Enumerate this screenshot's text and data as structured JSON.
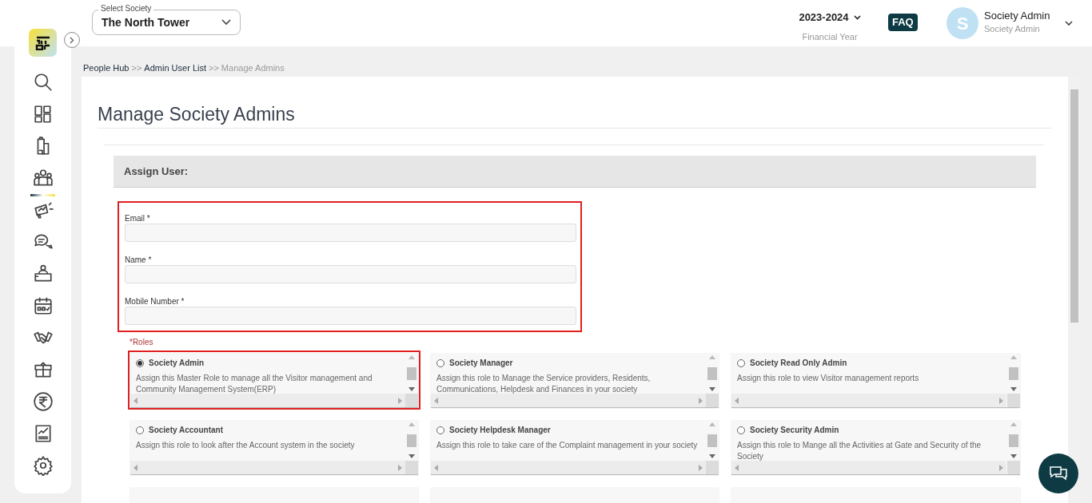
{
  "header": {
    "society_select": {
      "label": "Select Society",
      "value": "The North Tower"
    },
    "financial_year": {
      "value": "2023-2024",
      "label": "Financial Year"
    },
    "faq": "FAQ",
    "user": {
      "initial": "S",
      "name": "Society Admin",
      "role": "Society Admin"
    }
  },
  "sidebar": {
    "items": [
      {
        "kind": "search",
        "selected": false
      },
      {
        "kind": "dashboard",
        "selected": false
      },
      {
        "kind": "building",
        "selected": false
      },
      {
        "kind": "people",
        "selected": true
      },
      {
        "kind": "megaphone",
        "selected": false
      },
      {
        "kind": "chat",
        "selected": false
      },
      {
        "kind": "desk",
        "selected": false
      },
      {
        "kind": "calendar",
        "selected": false
      },
      {
        "kind": "handshake",
        "selected": false
      },
      {
        "kind": "box",
        "selected": false
      },
      {
        "kind": "rupee",
        "selected": false
      },
      {
        "kind": "report",
        "selected": false
      },
      {
        "kind": "settings",
        "selected": false
      }
    ]
  },
  "breadcrumb": [
    "People Hub",
    ">>",
    "Admin User List",
    ">>",
    "Manage Admins"
  ],
  "page_title": "Manage Society Admins",
  "section_title": "Assign User:",
  "form": {
    "highlighted": true,
    "fields": [
      {
        "label": "Email *"
      },
      {
        "label": "Name *"
      },
      {
        "label": "Mobile Number *"
      }
    ]
  },
  "roles_label": "*Roles",
  "roles": [
    {
      "name": "Society Admin",
      "description": "Assign this Master Role to manage all the Visitor management and Community Management System(ERP)",
      "selected": true,
      "highlighted": true
    },
    {
      "name": "Society Manager",
      "description": "Assign this role to Manage the Service providers, Residents, Communications, Helpdesk and Finances in your society",
      "selected": false,
      "highlighted": false
    },
    {
      "name": "Society Read Only Admin",
      "description": "Assign this role to view Visitor management reports",
      "selected": false,
      "highlighted": false
    },
    {
      "name": "Society Accountant",
      "description": "Assign this role to look after the Account system in the society",
      "selected": false,
      "highlighted": false
    },
    {
      "name": "Society Helpdesk Manager",
      "description": "Assign this role to take care of the Complaint management in your society",
      "selected": false,
      "highlighted": false
    },
    {
      "name": "Society Security Admin",
      "description": "Assign this role to Mange all the Activities at Gate and Security of the Society",
      "selected": false,
      "highlighted": false
    }
  ]
}
